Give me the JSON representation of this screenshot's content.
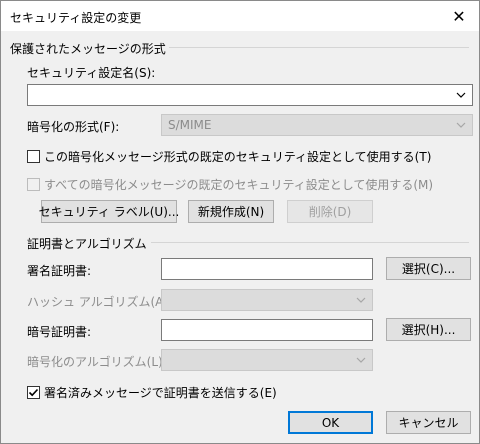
{
  "window": {
    "title": "セキュリティ設定の変更"
  },
  "group_protected": {
    "title": "保護されたメッセージの形式",
    "setting_name_label": "セキュリティ設定名(S):",
    "setting_name_value": "",
    "encryption_format_label": "暗号化の形式(F):",
    "encryption_format_value": "S/MIME",
    "default_for_format_label": "この暗号化メッセージ形式の既定のセキュリティ設定として使用する(T)",
    "default_for_format_checked": false,
    "default_for_all_label": "すべての暗号化メッセージの既定のセキュリティ設定として使用する(M)",
    "default_for_all_checked": false,
    "security_label_button": "セキュリティ ラベル(U)...",
    "new_button": "新規作成(N)",
    "delete_button": "削除(D)"
  },
  "group_certs": {
    "title": "証明書とアルゴリズム",
    "signing_cert_label": "署名証明書:",
    "signing_cert_value": "",
    "signing_choose_button": "選択(C)...",
    "hash_algo_label": "ハッシュ アルゴリズム(A):",
    "hash_algo_value": "",
    "encryption_cert_label": "暗号証明書:",
    "encryption_cert_value": "",
    "encryption_choose_button": "選択(H)...",
    "encryption_algo_label": "暗号化のアルゴリズム(L):",
    "encryption_algo_value": "",
    "send_certs_label": "署名済みメッセージで証明書を送信する(E)",
    "send_certs_checked": true
  },
  "footer": {
    "ok_button": "OK",
    "cancel_button": "キャンセル"
  },
  "icons": {
    "close": "close-icon",
    "dropdown": "chevron-down-icon",
    "check": "checkmark-icon"
  },
  "colors": {
    "accent": "#0078d7",
    "dialog_bg": "#f0f0f0",
    "disabled_text": "#8c8c8c"
  }
}
